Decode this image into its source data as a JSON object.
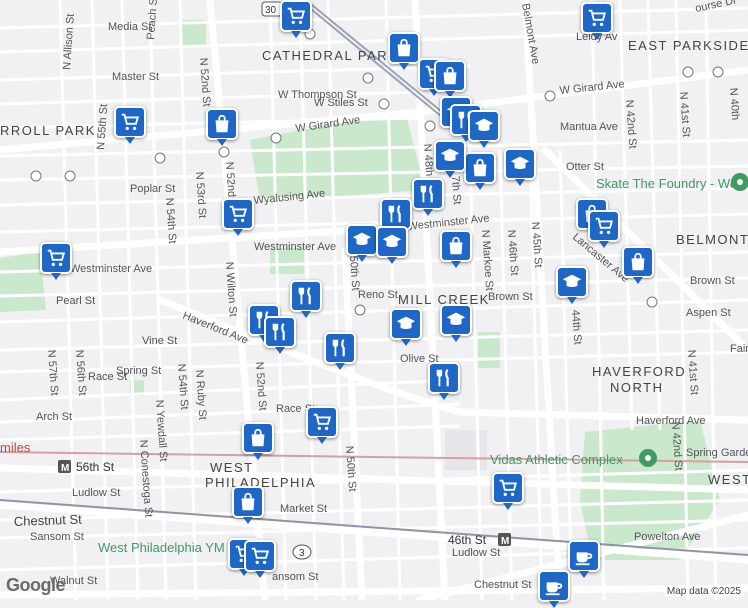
{
  "neighborhoods": {
    "cathedral_park": "CATHEDRAL PARK",
    "east_parkside": "EAST PARKSIDE",
    "carroll_park": "RROLL PARK",
    "belmont": "BELMONT",
    "mill_creek": "MILL CREEK",
    "haverford_north": "HAVERFORD\nNORTH",
    "haverford_north_1": "HAVERFORD",
    "haverford_north_2": "NORTH",
    "west_philadelphia_1": "WEST",
    "west_philadelphia_2": "PHILADELPHIA"
  },
  "streets": {
    "media": "Media St",
    "master": "Master St",
    "thompson": "W Thompson St",
    "stiles": "W Stiles St",
    "girard_w": "W Girard Ave",
    "girard_e": "W Girard Ave",
    "mantua": "Mantua Ave",
    "otter": "Otter St",
    "poplar": "Poplar St",
    "wyalusing": "Wyalusing Ave",
    "westminster_w": "Westminster Ave",
    "westminster_c": "Westminster Ave",
    "pearl": "Pearl St",
    "reno": "Reno St",
    "brown_c": "Brown St",
    "brown_e": "Brown St",
    "aspen": "Aspen St",
    "haverford_w": "Haverford Ave",
    "haverford_e": "Haverford Ave",
    "vine": "Vine St",
    "spring": "Spring St",
    "race_w": "Race St",
    "race_c": "Race St",
    "arch": "Arch St",
    "olive": "Olive St",
    "ludlow_w": "Ludlow St",
    "ludlow_e": "Ludlow St",
    "market": "Market St",
    "chestnut_w": "Chestnut St",
    "chestnut_e": "Chestnut St",
    "sansom_w": "Sansom St",
    "sansom_c": "ansom St",
    "walnut": "Walnut St",
    "powelton": "Powelton Ave",
    "spring_garden": "Spring Garde",
    "allison": "N Allison St",
    "n55th": "N 55th St",
    "peach": "Peach St",
    "n52nd_top": "N 52nd St",
    "n52nd_mid": "N 52nd St",
    "n52nd_low": "N 52nd St",
    "n53rd": "N 53rd St",
    "n54th": "N 54th St",
    "n54th_b": "N 54th St",
    "wilton": "N Wilton St",
    "n57th": "N 57th St",
    "n56th": "N 56th St",
    "conestoga": "N Conestoga St",
    "yewdall": "N Yewdall St",
    "ruby": "N Ruby St",
    "n50th": "N 50th St",
    "s50th": "50th St",
    "n48th": "N 48th",
    "n47th": "7th St",
    "n46th": "N 46th St",
    "n45th": "N 45th St",
    "markoe": "N Markoe St",
    "n44th": "44th St",
    "n42nd_top": "N 42nd St",
    "n42nd_low": "N 42nd St",
    "n41st_top": "N 41st St",
    "n41st_low": "N 41st St",
    "n40th": "N 40th",
    "belmont_ave": "Belmont Ave",
    "lancaster": "Lancaster Ave",
    "leidy": "Leidy Av",
    "fairm": "Fairm",
    "course": "ourse Dr",
    "r": "R",
    "reno_short": "Reno St",
    "ogden": "ogde",
    "wilt": "n St",
    "ast": "A",
    "n48_low": "8th",
    "e": "e",
    "e2": "e"
  },
  "places": {
    "skate": "Skate The Foundry - West Philly",
    "vidas": "Vidas Athletic Complex",
    "ymca": "West Philadelphia YM",
    "miles": "miles"
  },
  "transit": {
    "s56th": "56th St",
    "s46th": "46th St"
  },
  "route_shields": {
    "us30": "30",
    "pa3": "3"
  },
  "markers": [
    {
      "icon": "shopping-cart",
      "kind": "grocery"
    },
    {
      "icon": "shopping-cart",
      "kind": "grocery"
    },
    {
      "icon": "shopping-bag",
      "kind": "store"
    },
    {
      "icon": "shopping-cart",
      "kind": "grocery"
    },
    {
      "icon": "shopping-bag",
      "kind": "store"
    },
    {
      "icon": "shopping-cart",
      "kind": "grocery"
    },
    {
      "icon": "shopping-bag",
      "kind": "store"
    },
    {
      "icon": "graduation-cap",
      "kind": "school"
    },
    {
      "icon": "fork-knife",
      "kind": "restaurant"
    },
    {
      "icon": "graduation-cap",
      "kind": "school"
    },
    {
      "icon": "shopping-bag",
      "kind": "store"
    },
    {
      "icon": "graduation-cap",
      "kind": "school"
    },
    {
      "icon": "graduation-cap",
      "kind": "school"
    },
    {
      "icon": "fork-knife",
      "kind": "restaurant"
    },
    {
      "icon": "shopping-cart",
      "kind": "grocery"
    },
    {
      "icon": "fork-knife",
      "kind": "restaurant"
    },
    {
      "icon": "graduation-cap",
      "kind": "school"
    },
    {
      "icon": "graduation-cap",
      "kind": "school"
    },
    {
      "icon": "shopping-bag",
      "kind": "store"
    },
    {
      "icon": "shopping-bag",
      "kind": "store"
    },
    {
      "icon": "shopping-cart",
      "kind": "grocery"
    },
    {
      "icon": "shopping-bag",
      "kind": "store"
    },
    {
      "icon": "shopping-cart",
      "kind": "grocery"
    },
    {
      "icon": "graduation-cap",
      "kind": "school"
    },
    {
      "icon": "fork-knife",
      "kind": "restaurant"
    },
    {
      "icon": "fork-knife",
      "kind": "restaurant"
    },
    {
      "icon": "fork-knife",
      "kind": "restaurant"
    },
    {
      "icon": "fork-knife",
      "kind": "restaurant"
    },
    {
      "icon": "graduation-cap",
      "kind": "school"
    },
    {
      "icon": "graduation-cap",
      "kind": "school"
    },
    {
      "icon": "fork-knife",
      "kind": "restaurant"
    },
    {
      "icon": "shopping-cart",
      "kind": "grocery"
    },
    {
      "icon": "shopping-bag",
      "kind": "store"
    },
    {
      "icon": "shopping-bag",
      "kind": "store"
    },
    {
      "icon": "shopping-cart",
      "kind": "grocery"
    },
    {
      "icon": "shopping-cart",
      "kind": "grocery"
    },
    {
      "icon": "coffee-cup",
      "kind": "cafe"
    },
    {
      "icon": "coffee-cup",
      "kind": "cafe"
    },
    {
      "icon": "shopping-cart",
      "kind": "grocery"
    }
  ],
  "footer": {
    "logo": "Google",
    "attribution": "Map data ©2025"
  },
  "colors": {
    "background": "#f1f1f4",
    "road": "#ffffff",
    "park": "#c9e8cc",
    "rail": "#9aa3b4",
    "marker": "#1e67c7",
    "green_text": "#3f9a63"
  }
}
